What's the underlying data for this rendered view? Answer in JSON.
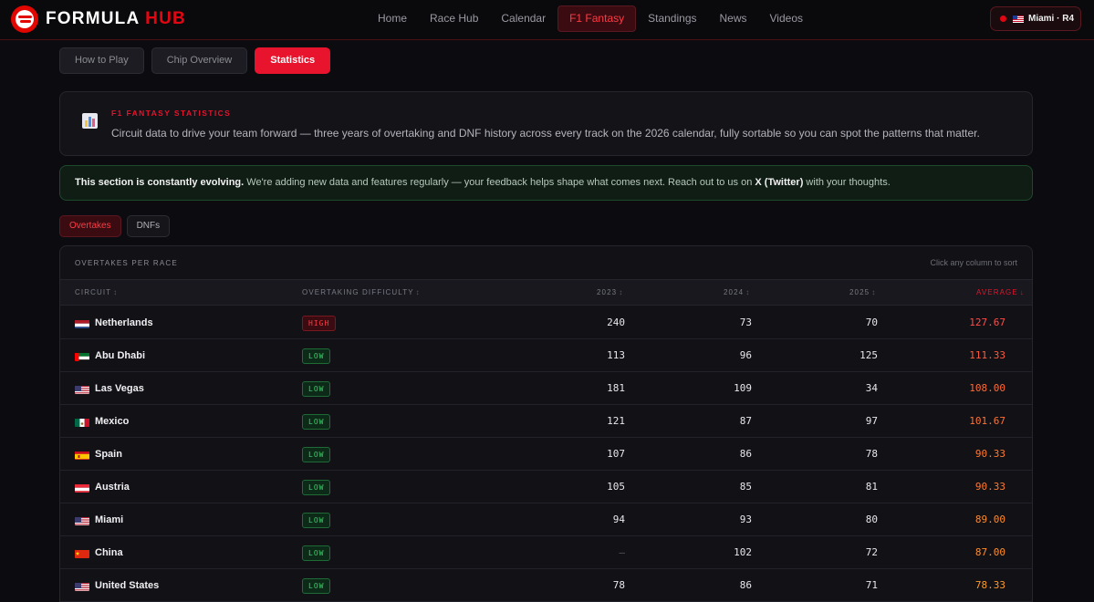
{
  "brand": {
    "name_main": "FORMULA",
    "name_accent": "HUB"
  },
  "nav": {
    "items": [
      {
        "label": "Home",
        "active": false
      },
      {
        "label": "Race Hub",
        "active": false
      },
      {
        "label": "Calendar",
        "active": false
      },
      {
        "label": "F1 Fantasy",
        "active": true
      },
      {
        "label": "Standings",
        "active": false
      },
      {
        "label": "News",
        "active": false
      },
      {
        "label": "Videos",
        "active": false
      }
    ]
  },
  "race_pill": {
    "label": "Miami · R4",
    "flag": "us-flag-icon"
  },
  "subtabs": [
    {
      "label": "How to Play",
      "active": false
    },
    {
      "label": "Chip Overview",
      "active": false
    },
    {
      "label": "Statistics",
      "active": true
    }
  ],
  "intro": {
    "kicker": "F1 FANTASY STATISTICS",
    "text": "Circuit data to drive your team forward — three years of overtaking and DNF history across every track on the 2026 calendar, fully sortable so you can spot the patterns that matter.",
    "icon": "bar-chart-icon"
  },
  "notice": {
    "bold": "This section is constantly evolving.",
    "text_before": " We're adding new data and features regularly — your feedback helps shape what comes next. Reach out to us on ",
    "link": "X (Twitter)",
    "text_after": " with your thoughts."
  },
  "datatabs": [
    {
      "label": "Overtakes",
      "active": true
    },
    {
      "label": "DNFs",
      "active": false
    }
  ],
  "table": {
    "title": "OVERTAKES PER RACE",
    "hint": "Click any column to sort",
    "columns": {
      "circuit": "CIRCUIT",
      "difficulty": "OVERTAKING DIFFICULTY",
      "y2023": "2023",
      "y2024": "2024",
      "y2025": "2025",
      "average": "AVERAGE"
    },
    "sort_glyph": "↕",
    "sort_active_glyph": "↓",
    "rows": [
      {
        "circuit": "Netherlands",
        "flag": "nl",
        "difficulty": "HIGH",
        "y2023": "240",
        "y2024": "73",
        "y2025": "70",
        "average": "127.67"
      },
      {
        "circuit": "Abu Dhabi",
        "flag": "ae",
        "difficulty": "LOW",
        "y2023": "113",
        "y2024": "96",
        "y2025": "125",
        "average": "111.33"
      },
      {
        "circuit": "Las Vegas",
        "flag": "us",
        "difficulty": "LOW",
        "y2023": "181",
        "y2024": "109",
        "y2025": "34",
        "average": "108.00"
      },
      {
        "circuit": "Mexico",
        "flag": "mx",
        "difficulty": "LOW",
        "y2023": "121",
        "y2024": "87",
        "y2025": "97",
        "average": "101.67"
      },
      {
        "circuit": "Spain",
        "flag": "es",
        "difficulty": "LOW",
        "y2023": "107",
        "y2024": "86",
        "y2025": "78",
        "average": "90.33"
      },
      {
        "circuit": "Austria",
        "flag": "at",
        "difficulty": "LOW",
        "y2023": "105",
        "y2024": "85",
        "y2025": "81",
        "average": "90.33"
      },
      {
        "circuit": "Miami",
        "flag": "us",
        "difficulty": "LOW",
        "y2023": "94",
        "y2024": "93",
        "y2025": "80",
        "average": "89.00"
      },
      {
        "circuit": "China",
        "flag": "cn",
        "difficulty": "LOW",
        "y2023": "—",
        "y2024": "102",
        "y2025": "72",
        "average": "87.00"
      },
      {
        "circuit": "United States",
        "flag": "us",
        "difficulty": "LOW",
        "y2023": "78",
        "y2024": "86",
        "y2025": "71",
        "average": "78.33"
      }
    ]
  },
  "colors": {
    "accent": "#e8132c",
    "low": "#3ecf6a",
    "high": "#ff3b45",
    "average_gradient": [
      "#ff4d4a",
      "#ff5a3c",
      "#ff6a36",
      "#ff7232",
      "#ff7a30",
      "#ff7a30",
      "#ff8a2c",
      "#ff8e2a",
      "#ff9a28"
    ]
  }
}
